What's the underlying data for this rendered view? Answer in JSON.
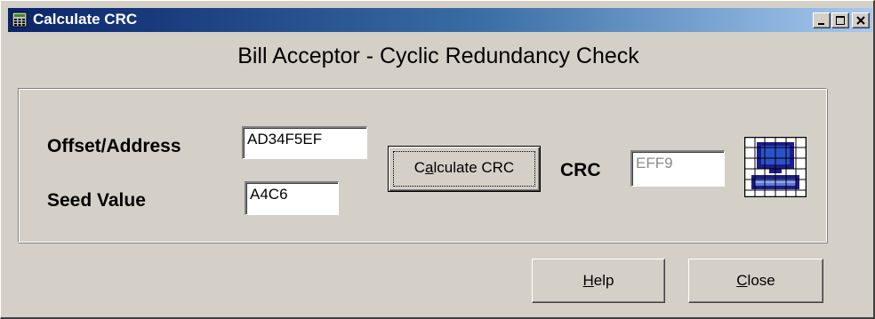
{
  "window": {
    "title": "Calculate CRC",
    "heading": "Bill Acceptor - Cyclic Redundancy Check",
    "controls": {
      "minimize_icon": "minimize-icon",
      "maximize_icon": "maximize-icon",
      "close_icon": "close-icon"
    },
    "colors": {
      "face": "#d4d0c8",
      "title_active": "#0a246a",
      "title_gradient_end": "#a6caf0"
    }
  },
  "form": {
    "offset_label": "Offset/Address",
    "offset_value": "AD34F5EF",
    "seed_label": "Seed Value",
    "seed_value": "A4C6",
    "calculate_button": {
      "label": "Calculate CRC",
      "mnemonic": "a"
    },
    "crc_label": "CRC",
    "crc_value": "EFF9",
    "crc_icon": "computer-grid-icon"
  },
  "buttons": {
    "help": {
      "label": "Help",
      "mnemonic": "H"
    },
    "close": {
      "label": "Close",
      "mnemonic": "C"
    }
  }
}
